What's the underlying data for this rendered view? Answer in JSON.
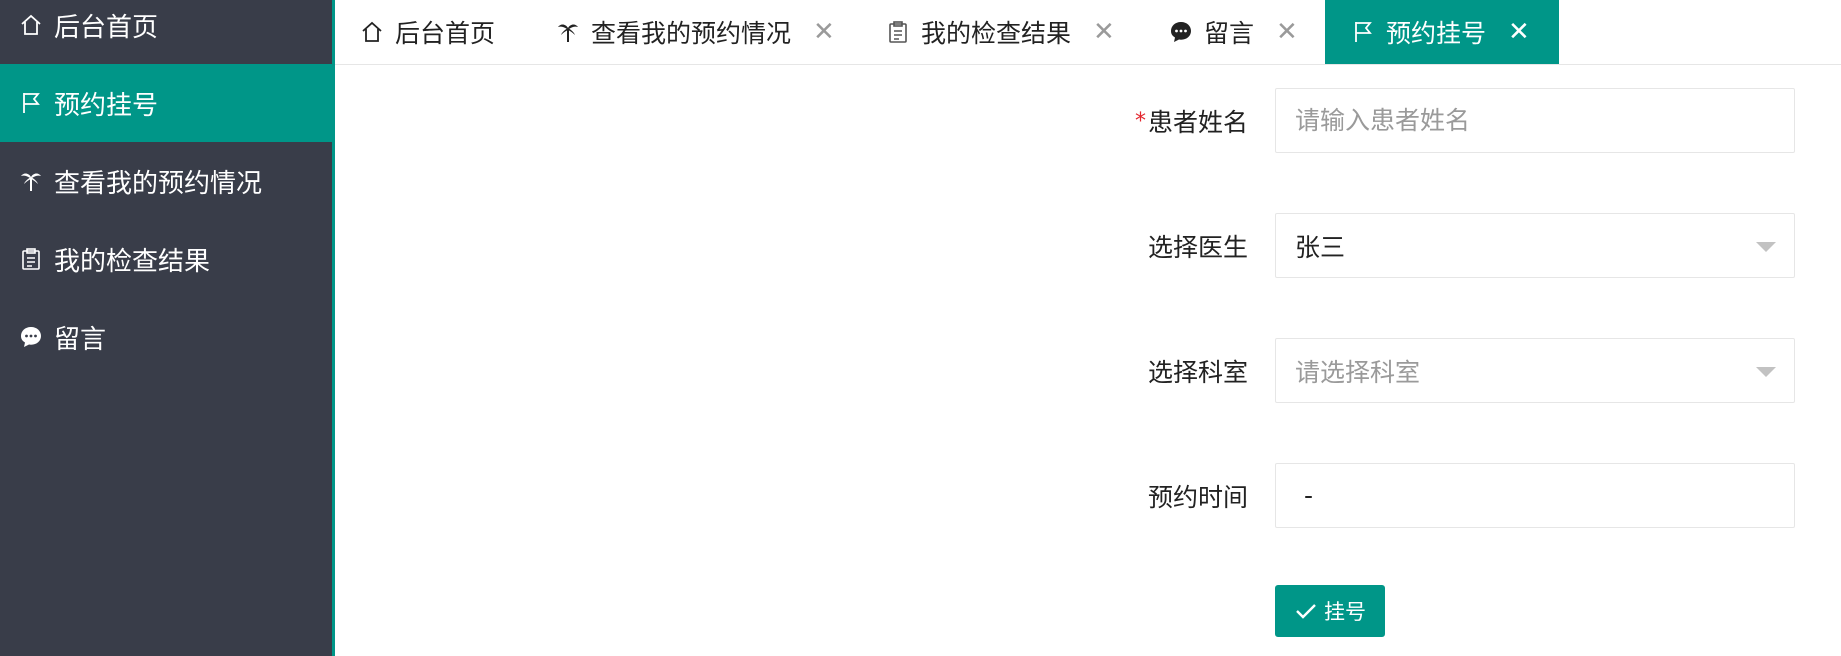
{
  "sidebar": {
    "items": [
      {
        "label": "后台首页",
        "icon": "home-icon"
      },
      {
        "label": "预约挂号",
        "icon": "flag-icon",
        "active": true
      },
      {
        "label": "查看我的预约情况",
        "icon": "palm-tree-icon"
      },
      {
        "label": "我的检查结果",
        "icon": "clipboard-icon"
      },
      {
        "label": "留言",
        "icon": "chat-bubble-icon"
      }
    ]
  },
  "tabs": [
    {
      "label": "后台首页",
      "icon": "home-icon",
      "closable": false
    },
    {
      "label": "查看我的预约情况",
      "icon": "palm-tree-icon",
      "closable": true,
      "close": "✕"
    },
    {
      "label": "我的检查结果",
      "icon": "clipboard-icon",
      "closable": true,
      "close": "✕"
    },
    {
      "label": "留言",
      "icon": "chat-bubble-icon",
      "closable": true,
      "close": "✕"
    },
    {
      "label": "预约挂号",
      "icon": "flag-icon",
      "closable": true,
      "close": "✕",
      "active": true
    }
  ],
  "form": {
    "patient_name": {
      "required_mark": "*",
      "label": "患者姓名",
      "placeholder": "请输入患者姓名",
      "value": ""
    },
    "doctor": {
      "label": "选择医生",
      "value": "张三"
    },
    "department": {
      "label": "选择科室",
      "placeholder": "请选择科室"
    },
    "time": {
      "label": "预约时间",
      "value": "-"
    },
    "submit_label": "挂号"
  },
  "colors": {
    "accent": "#009688",
    "sidebar_bg": "#393d49",
    "required": "#e3262e",
    "placeholder": "#9a9a9a"
  }
}
